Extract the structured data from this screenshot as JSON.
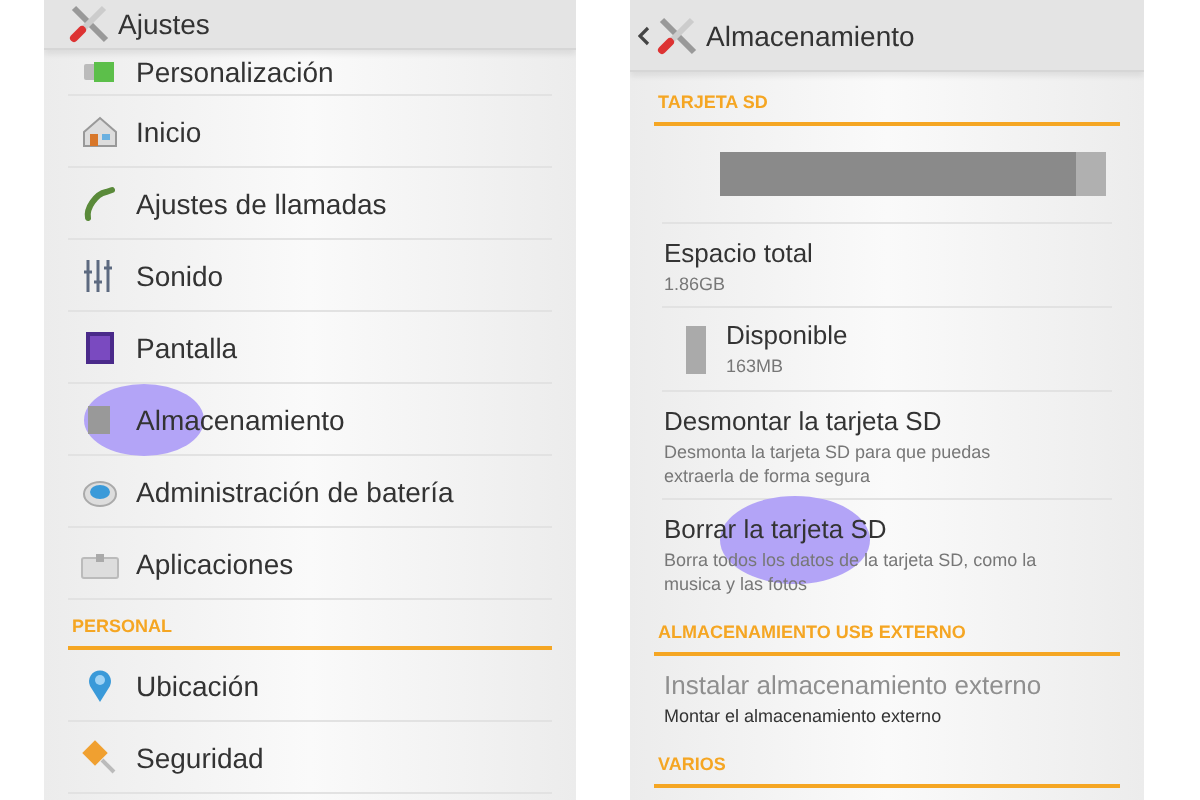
{
  "settings_screen": {
    "title": "Ajustes",
    "rows": [
      {
        "kind": "item",
        "label": "Personalización",
        "tapped": false
      },
      {
        "kind": "item",
        "label": "Inicio",
        "tapped": false
      },
      {
        "kind": "item",
        "label": "Ajustes de llamadas",
        "tapped": false
      },
      {
        "kind": "item",
        "label": "Sonido",
        "tapped": false
      },
      {
        "kind": "item",
        "label": "Pantalla",
        "tapped": false
      },
      {
        "kind": "item",
        "label": "Almacenamiento",
        "tapped": true
      },
      {
        "kind": "item",
        "label": "Administración de batería",
        "tapped": false
      },
      {
        "kind": "item",
        "label": "Aplicaciones",
        "tapped": false
      },
      {
        "kind": "header",
        "label": "PERSONAL"
      },
      {
        "kind": "item",
        "label": "Ubicación",
        "tapped": false
      },
      {
        "kind": "item",
        "label": "Seguridad",
        "tapped": false
      }
    ]
  },
  "storage_screen": {
    "title": "Almacenamiento",
    "rows": [
      {
        "kind": "header",
        "label": "TARJETA SD"
      },
      {
        "kind": "bar",
        "level": 0.92
      },
      {
        "kind": "entry",
        "title": "Espacio total",
        "subtitle": "1.86GB",
        "disabled": false,
        "tapped": false
      },
      {
        "kind": "legend",
        "title": "Disponible",
        "subtitle": "163MB"
      },
      {
        "kind": "entry",
        "title": "Desmontar la tarjeta SD",
        "subtitle": "Desmonta la tarjeta SD para que puedas extraerla de forma segura",
        "disabled": false,
        "tapped": false
      },
      {
        "kind": "entry",
        "title": "Borrar la tarjeta SD",
        "subtitle": "Borra todos los datos de la tarjeta SD, como la musica y las fotos",
        "disabled": false,
        "tapped": true
      },
      {
        "kind": "header",
        "label": "ALMACENAMIENTO USB EXTERNO"
      },
      {
        "kind": "entry",
        "title": "Instalar almacenamiento externo",
        "subtitle": "Montar el almacenamiento externo",
        "disabled": true,
        "tapped": false
      },
      {
        "kind": "header",
        "label": "VARIOS"
      }
    ]
  }
}
